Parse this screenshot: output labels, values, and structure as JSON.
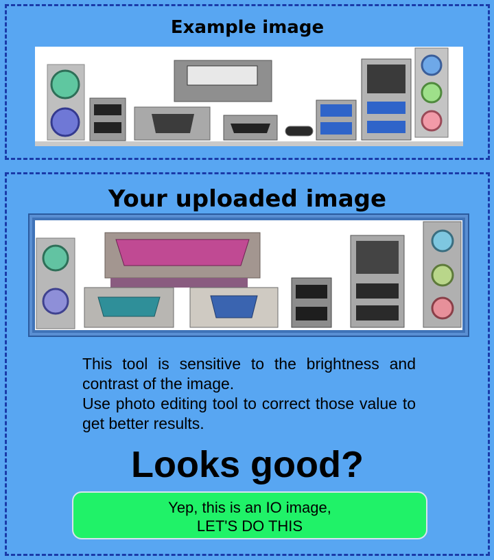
{
  "example": {
    "title": "Example image"
  },
  "upload": {
    "title": "Your uploaded image",
    "info": {
      "line1": "This tool is sensitive to the brightness and contrast of the image.",
      "line2": "Use photo editing tool to correct those value to get better results."
    },
    "prompt": "Looks good?",
    "confirm_button": {
      "line1": "Yep, this is an IO image,",
      "line2": "LET'S DO THIS"
    }
  },
  "colors": {
    "background": "#58a6f2",
    "border": "#1a3aa8",
    "button": "#20f268"
  }
}
